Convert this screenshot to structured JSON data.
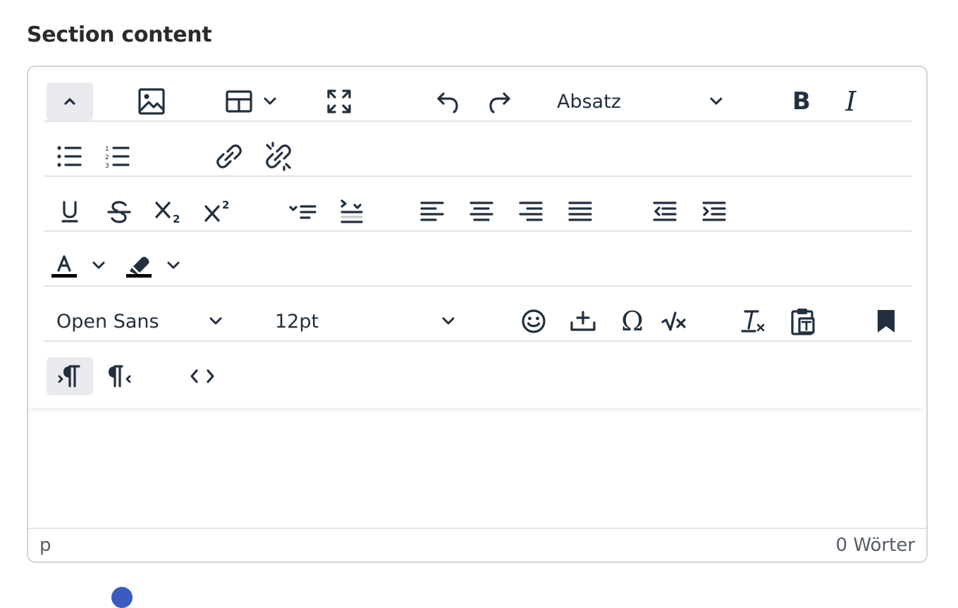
{
  "section": {
    "title": "Section content"
  },
  "toolbar": {
    "block_format": {
      "value": "Absatz"
    },
    "font_family": {
      "value": "Open Sans"
    },
    "font_size": {
      "value": "12pt"
    },
    "icons": [
      "chevron-up-icon",
      "image-icon",
      "table-icon",
      "fullscreen-icon",
      "undo-icon",
      "redo-icon",
      "bold-icon",
      "italic-icon",
      "bullet-list-icon",
      "numbered-list-icon",
      "link-icon",
      "unlink-icon",
      "underline-icon",
      "strikethrough-icon",
      "subscript-icon",
      "superscript-icon",
      "checklist-icon",
      "checklist-rtl-icon",
      "align-left-icon",
      "align-center-icon",
      "align-right-icon",
      "align-justify-icon",
      "outdent-icon",
      "indent-icon",
      "text-color-icon",
      "highlight-color-icon",
      "emoji-icon",
      "insert-template-icon",
      "omega-icon",
      "math-icon",
      "clear-formatting-icon",
      "paste-text-icon",
      "bookmark-icon",
      "ltr-icon",
      "rtl-icon",
      "source-code-icon"
    ]
  },
  "statusbar": {
    "path": "p",
    "wordcount": "0 Wörter"
  },
  "colors": {
    "text_color_bar": "#000000",
    "highlight_bar": "#000000",
    "active_button_bg": "#e8eaed",
    "border": "#cfd3d8"
  }
}
